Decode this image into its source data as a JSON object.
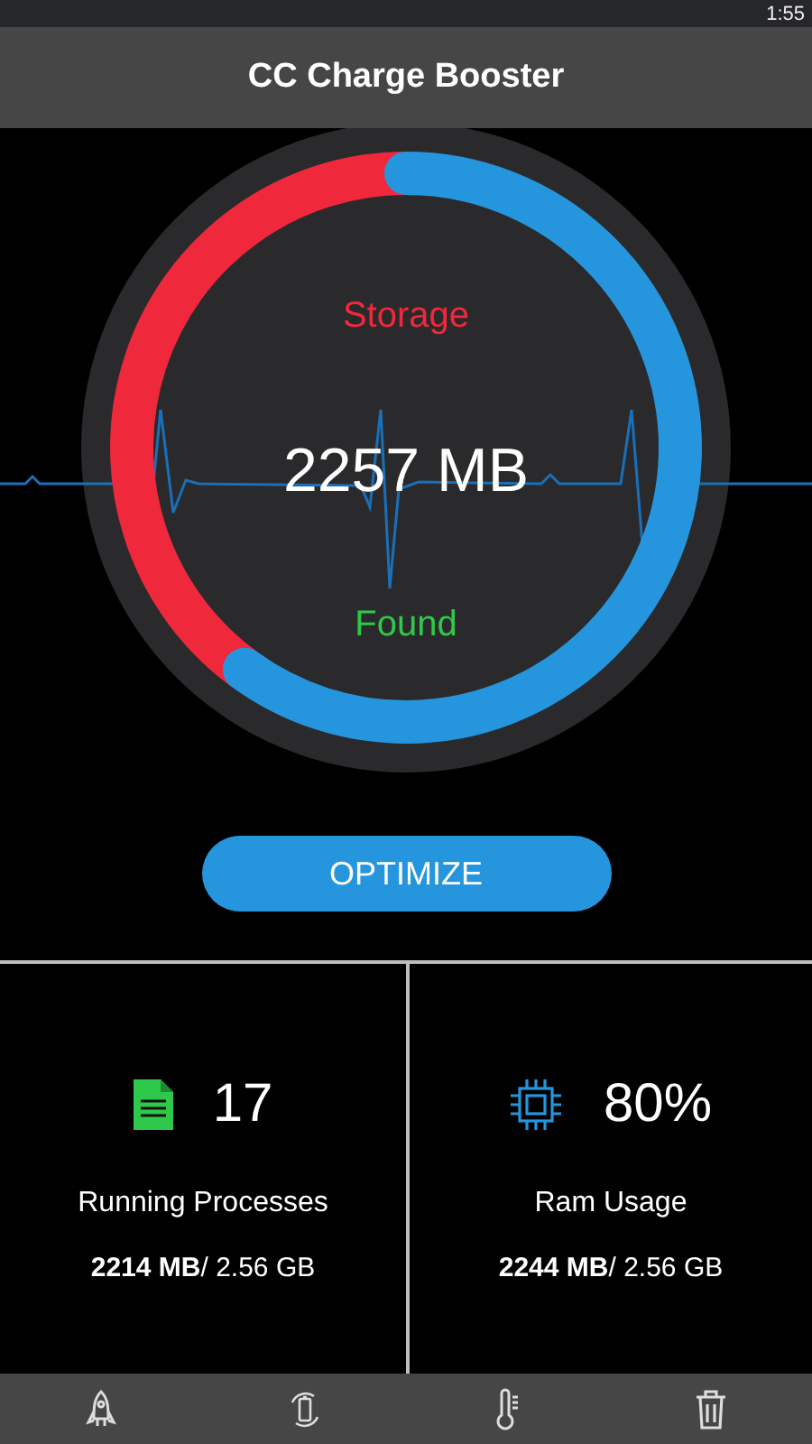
{
  "status_bar": {
    "time": "1:55"
  },
  "app_bar": {
    "title": "CC Charge Booster"
  },
  "gauge": {
    "label": "Storage",
    "value": "2257 MB",
    "caption": "Found",
    "level": 0.6
  },
  "optimize_button": {
    "label": "OPTIMIZE"
  },
  "stats": [
    {
      "kind": "processes",
      "value": "17",
      "label": "Running Processes",
      "detail": "**2214 MB**/ 2.56 GB"
    },
    {
      "kind": "ram",
      "value": "80%",
      "label": "Ram Usage",
      "detail": "**2244 MB**/ 2.56 GB"
    }
  ]
}
